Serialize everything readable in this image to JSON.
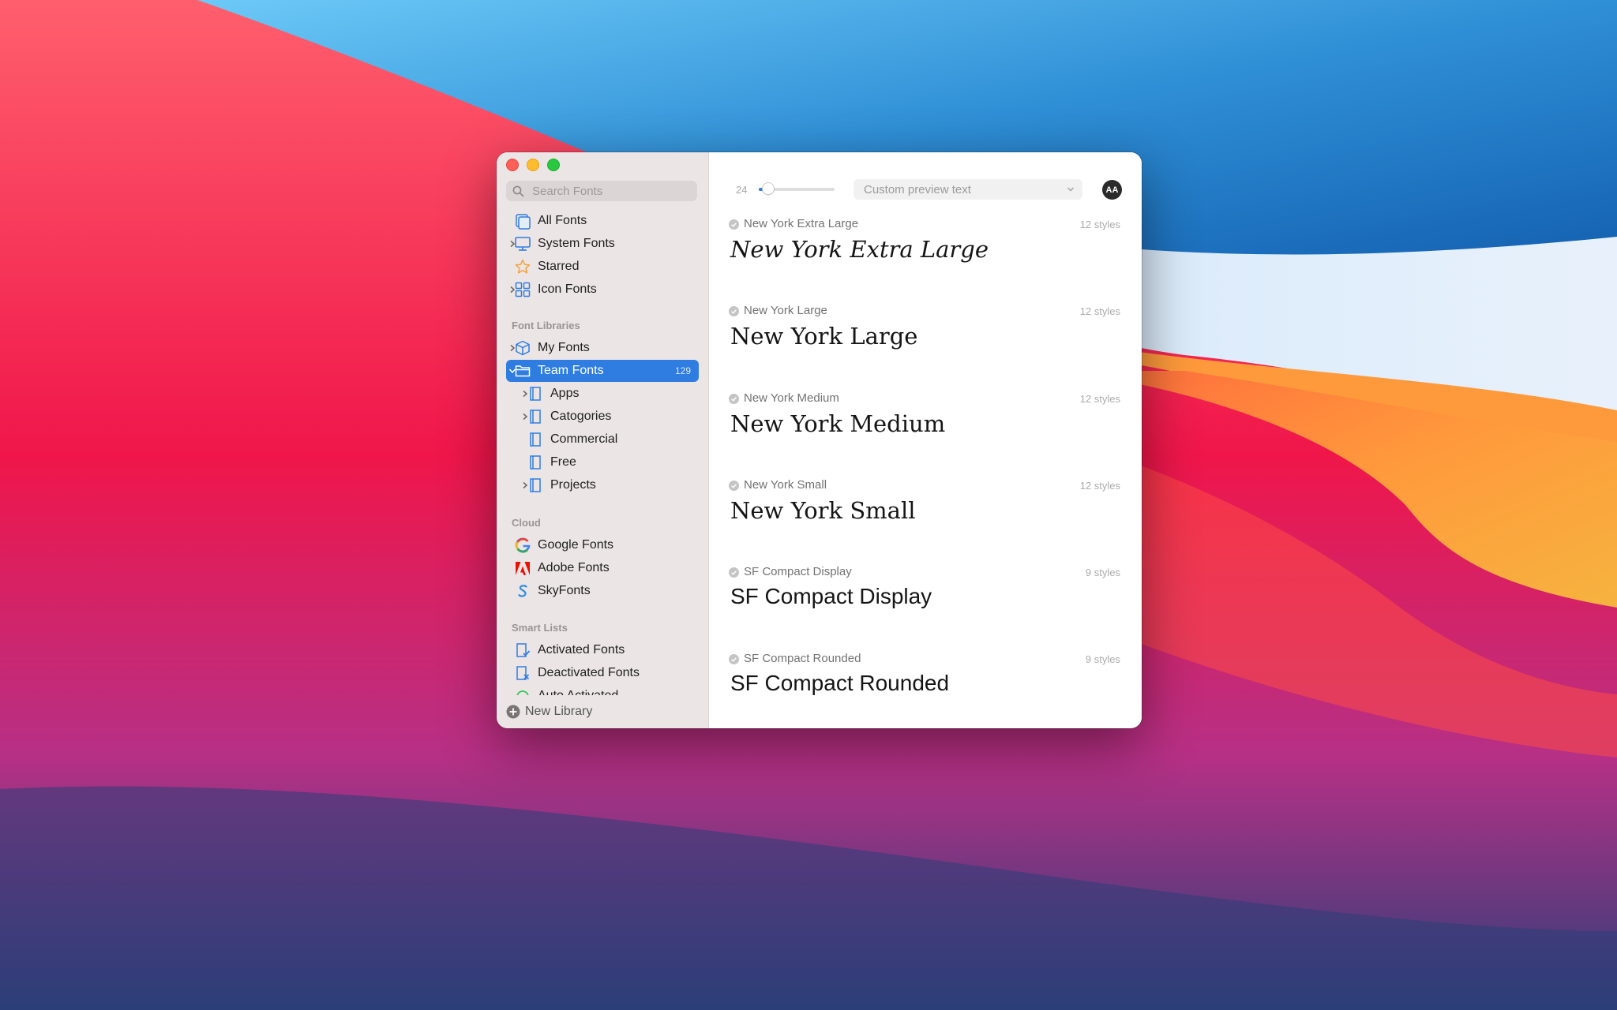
{
  "colors": {
    "accent": "#2f7de1",
    "sidebar_bg": "#ece5e6",
    "close": "#ff5f57",
    "minimize": "#febc2e",
    "maximize": "#28c840"
  },
  "search": {
    "placeholder": "Search Fonts"
  },
  "sidebar": {
    "top_items": [
      {
        "label": "All Fonts",
        "icon": "all-fonts-icon",
        "expandable": false
      },
      {
        "label": "System Fonts",
        "icon": "monitor-icon",
        "expandable": true
      },
      {
        "label": "Starred",
        "icon": "star-icon",
        "expandable": false
      },
      {
        "label": "Icon Fonts",
        "icon": "grid-icon",
        "expandable": true
      }
    ],
    "libraries_header": "Font Libraries",
    "libraries": [
      {
        "label": "My Fonts",
        "icon": "box-icon",
        "expandable": true
      },
      {
        "label": "Team Fonts",
        "icon": "folder-icon",
        "expandable": true,
        "expanded": true,
        "selected": true,
        "count": "129"
      }
    ],
    "team_children": [
      {
        "label": "Apps",
        "icon": "collection-icon",
        "expandable": true
      },
      {
        "label": "Catogories",
        "icon": "collection-icon",
        "expandable": true
      },
      {
        "label": "Commercial",
        "icon": "collection-icon",
        "expandable": false
      },
      {
        "label": "Free",
        "icon": "collection-icon",
        "expandable": false
      },
      {
        "label": "Projects",
        "icon": "collection-icon",
        "expandable": true
      }
    ],
    "cloud_header": "Cloud",
    "cloud": [
      {
        "label": "Google Fonts",
        "icon": "google-icon"
      },
      {
        "label": "Adobe Fonts",
        "icon": "adobe-icon"
      },
      {
        "label": "SkyFonts",
        "icon": "skyfonts-icon"
      }
    ],
    "smart_header": "Smart Lists",
    "smart": [
      {
        "label": "Activated Fonts",
        "icon": "activated-icon"
      },
      {
        "label": "Deactivated Fonts",
        "icon": "deactivated-icon"
      },
      {
        "label": "Auto Activated",
        "icon": "auto-activated-icon"
      }
    ],
    "new_library": "New Library"
  },
  "toolbar": {
    "size": "24",
    "size_slider_level": 0.12,
    "preview_placeholder": "Custom preview text",
    "aa_button": "AA"
  },
  "fonts": [
    {
      "name": "New York Extra Large",
      "styles": "12 styles",
      "preview": "New York Extra Large"
    },
    {
      "name": "New York Large",
      "styles": "12 styles",
      "preview": "New York Large"
    },
    {
      "name": "New York Medium",
      "styles": "12 styles",
      "preview": "New York Medium"
    },
    {
      "name": "New York Small",
      "styles": "12 styles",
      "preview": "New York Small"
    },
    {
      "name": "SF Compact Display",
      "styles": "9 styles",
      "preview": "SF Compact Display"
    },
    {
      "name": "SF Compact Rounded",
      "styles": "9 styles",
      "preview": "SF Compact Rounded"
    }
  ]
}
